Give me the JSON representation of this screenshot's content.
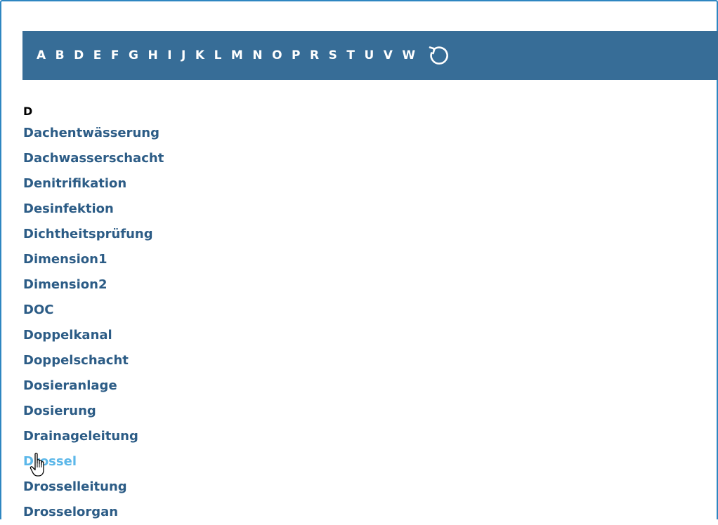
{
  "alphabet_nav": {
    "letters": [
      "A",
      "B",
      "D",
      "E",
      "F",
      "G",
      "H",
      "I",
      "J",
      "K",
      "L",
      "M",
      "N",
      "O",
      "P",
      "R",
      "S",
      "T",
      "U",
      "V",
      "W"
    ],
    "reset_icon": "reset-icon"
  },
  "glossary": {
    "section_letter": "D",
    "terms": [
      "Dachentwässerung",
      "Dachwasserschacht",
      "Denitrifikation",
      "Desinfektion",
      "Dichtheitsprüfung",
      "Dimension1",
      "Dimension2",
      "DOC",
      "Doppelkanal",
      "Doppelschacht",
      "Dosieranlage",
      "Dosierung",
      "Drainageleitung",
      "Drossel",
      "Drosselleitung",
      "Drosselorgan"
    ],
    "hovered_term": "Drossel"
  },
  "colors": {
    "nav_background": "#376d97",
    "link": "#2c5c86",
    "link_hover": "#5bb7e9",
    "frame_border": "#2e86c1"
  },
  "cursor_icon": "hand-pointer-icon"
}
